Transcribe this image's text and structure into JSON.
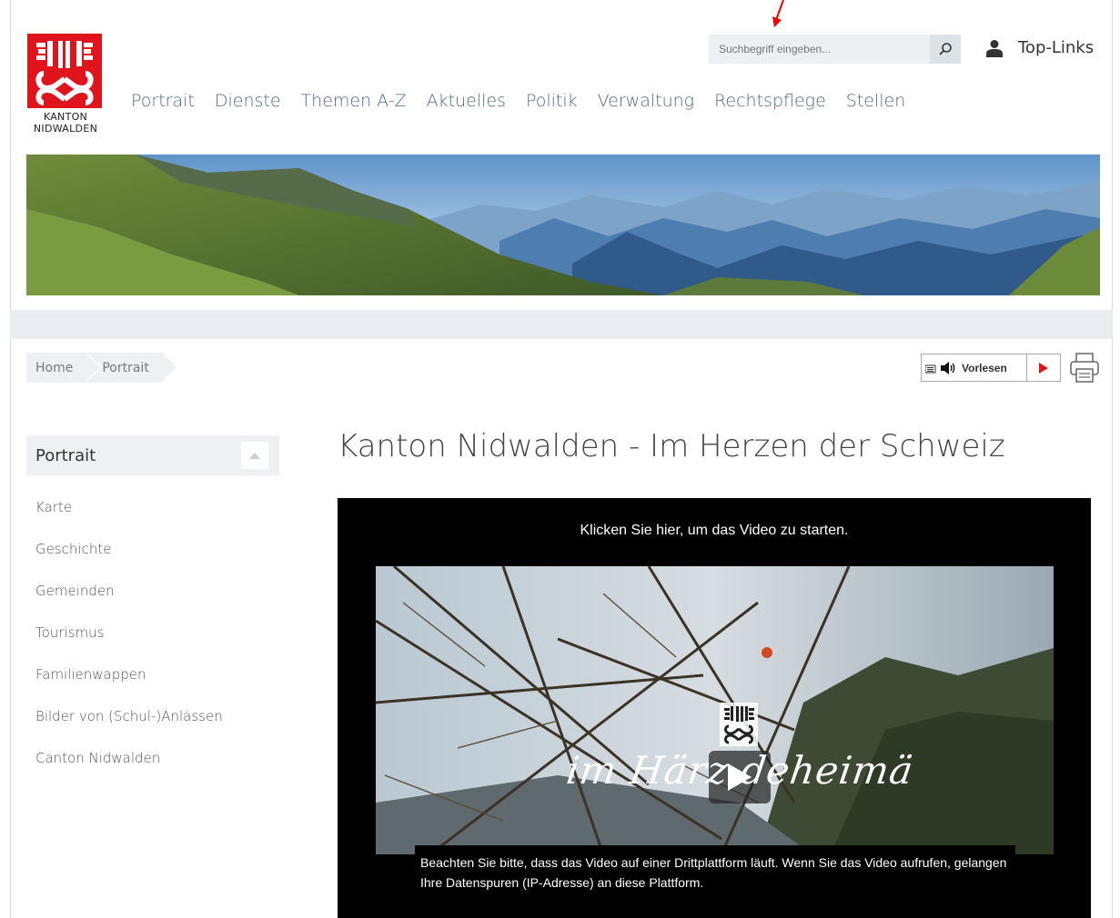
{
  "header": {
    "logo": {
      "line1": "KANTON",
      "line2": "NIDWALDEN",
      "color": "#e0141c"
    },
    "search": {
      "placeholder": "Suchbegriff eingeben...",
      "icon": "search-icon"
    },
    "toplinks": {
      "label": "Top-Links",
      "icon": "user-icon"
    },
    "nav": [
      "Portrait",
      "Dienste",
      "Themen A-Z",
      "Aktuelles",
      "Politik",
      "Verwaltung",
      "Rechtspflege",
      "Stellen"
    ]
  },
  "breadcrumb": [
    "Home",
    "Portrait"
  ],
  "readaloud": {
    "label": "Vorlesen",
    "accent": "#e0141c"
  },
  "sidebar": {
    "title": "Portrait",
    "items": [
      "Karte",
      "Geschichte",
      "Gemeinden",
      "Tourismus",
      "Familienwappen",
      "Bilder von (Schul-)Anlässen",
      "Canton Nidwalden"
    ]
  },
  "main": {
    "title": "Kanton Nidwalden - Im Herzen der Schweiz",
    "video": {
      "cta": "Klicken Sie hier, um das Video zu starten.",
      "overlay_text": "im Härz deheimä",
      "disclaimer": "Beachten Sie bitte, dass das Video auf einer Drittplattform läuft. Wenn Sie das Video aufrufen, gelangen Ihre Datenspuren (IP-Adresse) an diese Plattform."
    }
  }
}
